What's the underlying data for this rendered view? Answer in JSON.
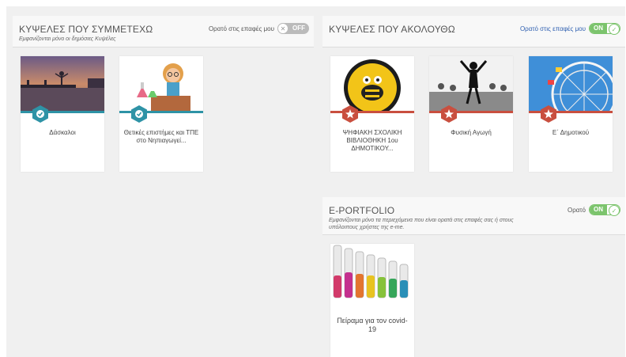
{
  "colors": {
    "teal": "#2e93a6",
    "red": "#c94f3f",
    "green": "#7cc46d",
    "off": "#bbbbbb"
  },
  "participate": {
    "title": "ΚΥΨΕΛΕΣ ΠΟΥ ΣΥΜΜΕΤΕΧΩ",
    "subtitle": "Εμφανίζονται μόνο οι δημόσιες Κυψέλες",
    "visibility_label": "Ορατό στις επαφές μου",
    "toggle_text": "OFF",
    "cards": [
      {
        "label": "Δάσκαλοι",
        "badge": "check-icon"
      },
      {
        "label": "Θετικές επιστήμες και ΤΠΕ στο Νηπιαγωγεί...",
        "badge": "check-icon"
      }
    ]
  },
  "follow": {
    "title": "ΚΥΨΕΛΕΣ ΠΟΥ ΑΚΟΛΟΥΘΩ",
    "visibility_label": "Ορατό στις επαφές μου",
    "toggle_text": "ON",
    "cards": [
      {
        "label": "ΨΗΦΙΑΚΗ ΣΧΟΛΙΚΗ ΒΙΒΛΙΟΘΗΚΗ 1ου ΔΗΜΟΤΙΚΟΥ...",
        "badge": "star-icon"
      },
      {
        "label": "Φυσική Αγωγή",
        "badge": "star-icon"
      },
      {
        "label": "Ε΄ Δημοτικού",
        "badge": "star-icon"
      }
    ]
  },
  "portfolio": {
    "title": "E-PORTFOLIO",
    "subtitle": "Εμφανίζονται μόνο τα περιεχόμενα που είναι ορατά στις επαφές σας ή στους υπόλοιπους χρήστες της e-me.",
    "visibility_label": "Ορατό",
    "toggle_text": "ON",
    "cards": [
      {
        "label": "Πείραμα για τον covid-19"
      }
    ]
  }
}
